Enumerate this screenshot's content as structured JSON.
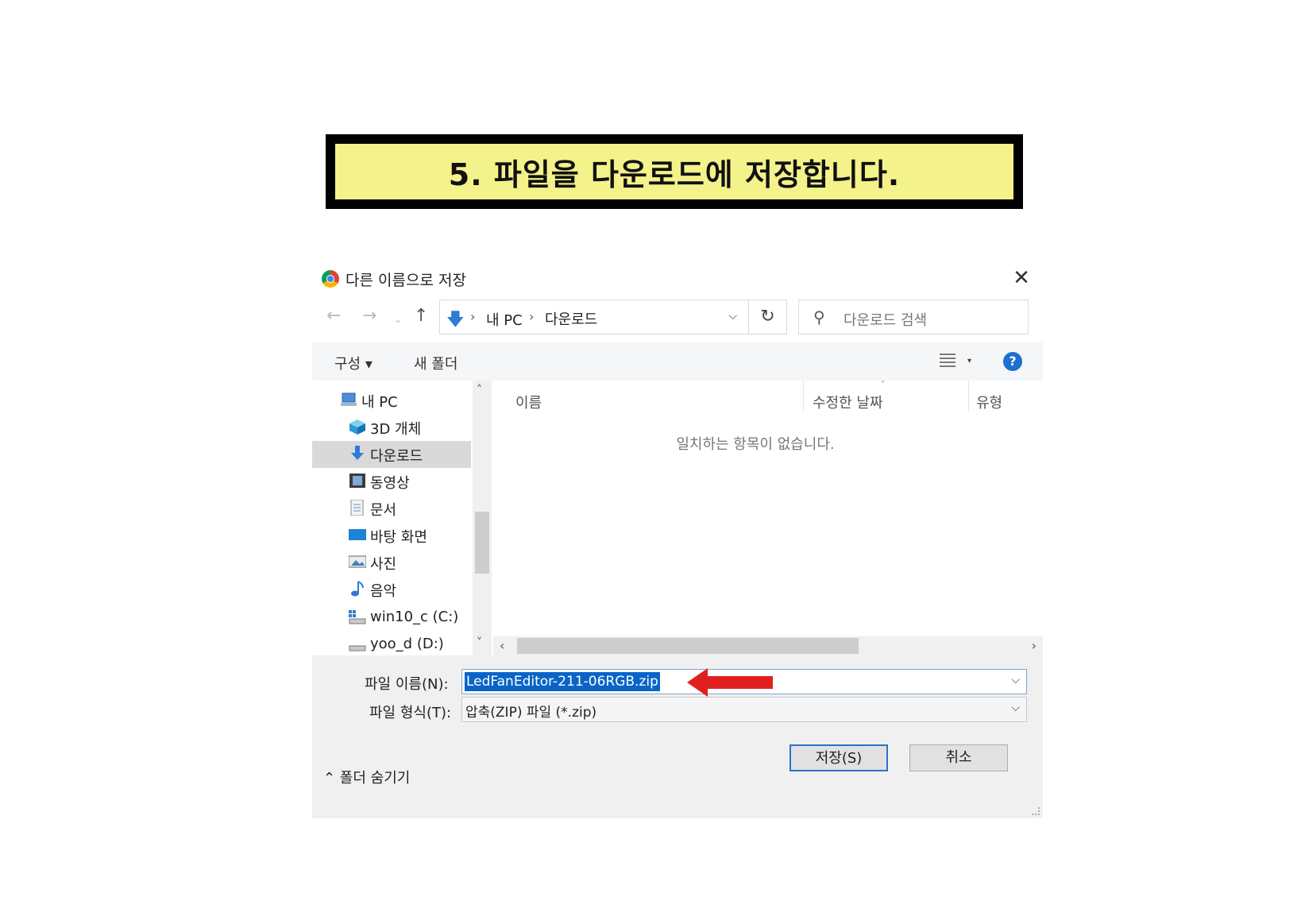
{
  "banner": {
    "text": "5. 파일을 다운로드에 저장합니다."
  },
  "dialog": {
    "title": "다른 이름으로 저장",
    "close_glyph": "✕",
    "nav": {
      "back": "←",
      "forward": "→",
      "recent": "⌄",
      "up": "↑"
    },
    "address": {
      "sep": "›",
      "pc": "내 PC",
      "folder": "다운로드",
      "dropdown": "⌵"
    },
    "refresh": "↻",
    "search_placeholder": "다운로드 검색",
    "toolbar": {
      "organize": "구성 ▾",
      "new_folder": "새 폴더",
      "view_drop": "▾",
      "help": "?"
    },
    "sidebar": {
      "items": [
        {
          "label": "내 PC",
          "icon": "computer-icon"
        },
        {
          "label": "3D 개체",
          "icon": "cube-icon"
        },
        {
          "label": "다운로드",
          "icon": "download-icon",
          "selected": true
        },
        {
          "label": "동영상",
          "icon": "video-icon"
        },
        {
          "label": "문서",
          "icon": "document-icon"
        },
        {
          "label": "바탕 화면",
          "icon": "desktop-icon"
        },
        {
          "label": "사진",
          "icon": "picture-icon"
        },
        {
          "label": "음악",
          "icon": "music-icon"
        },
        {
          "label": "win10_c (C:)",
          "icon": "drive-icon"
        },
        {
          "label": "yoo_d (D:)",
          "icon": "drive-icon"
        }
      ],
      "scroll_up": "˄",
      "scroll_down": "˅"
    },
    "filelist": {
      "columns": [
        "이름",
        "수정한 날짜",
        "유형"
      ],
      "sort_arrow": "˅",
      "empty_message": "일치하는 항목이 없습니다.",
      "scroll_left": "‹",
      "scroll_right": "›"
    },
    "form": {
      "filename_label": "파일 이름(N):",
      "filename_value": "LedFanEditor-211-06RGB.zip",
      "filetype_label": "파일 형식(T):",
      "filetype_value": "압축(ZIP) 파일 (*.zip)",
      "dropdown": "⌵"
    },
    "hide_folders": "⌃ 폴더 숨기기",
    "buttons": {
      "save": "저장(S)",
      "cancel": "취소"
    },
    "colors": {
      "accent": "#0a64c8",
      "arrow": "#e02020",
      "banner_bg": "#f4f28a"
    }
  }
}
